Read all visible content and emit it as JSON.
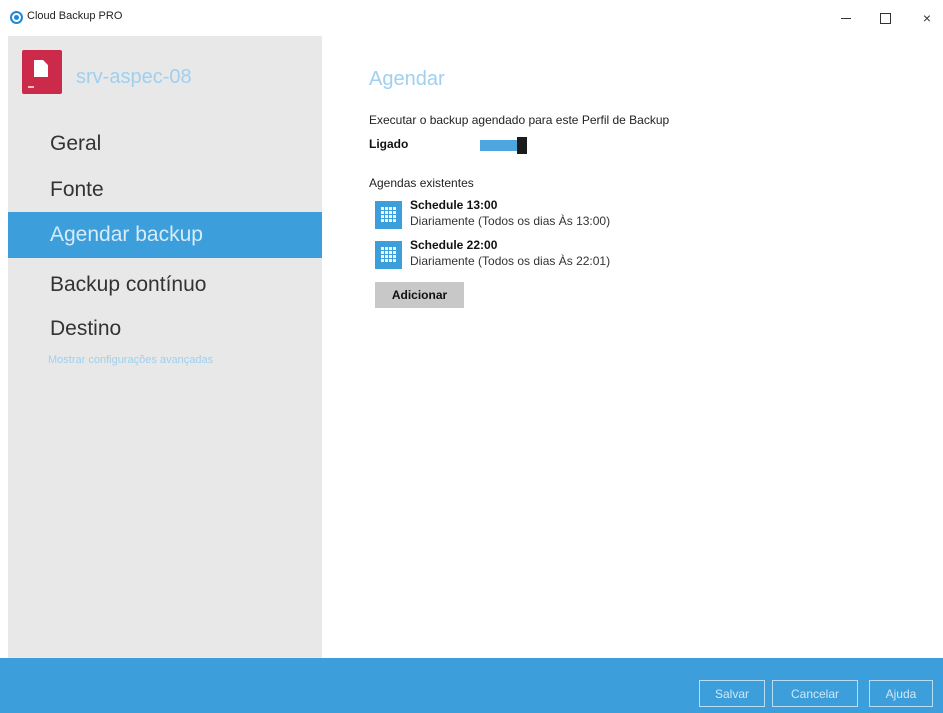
{
  "window": {
    "title": "Cloud Backup PRO",
    "minimize": "",
    "maximize": "",
    "close": "×"
  },
  "sidebar": {
    "profile_name": "srv-aspec-08",
    "items": [
      {
        "label": "Geral",
        "active": false
      },
      {
        "label": "Fonte",
        "active": false
      },
      {
        "label": "Agendar backup",
        "active": true
      },
      {
        "label": "Backup contínuo",
        "active": false
      },
      {
        "label": "Destino",
        "active": false
      }
    ],
    "advanced_link": "Mostrar configurações avançadas"
  },
  "main": {
    "title": "Agendar",
    "description": "Executar o backup agendado para este Perfil de Backup",
    "toggle_label": "Ligado",
    "toggle_on": true,
    "schedules_label": "Agendas existentes",
    "schedules": [
      {
        "name": "Schedule 13:00",
        "detail": "Diariamente (Todos os dias Às 13:00)"
      },
      {
        "name": "Schedule 22:00",
        "detail": "Diariamente (Todos os dias Às 22:01)"
      }
    ],
    "add_label": "Adicionar"
  },
  "footer": {
    "save_label": "Salvar",
    "cancel_label": "Cancelar",
    "help_label": "Ajuda"
  },
  "colors": {
    "accent": "#3c9fdb",
    "light_accent": "#9fd0ef",
    "profile_icon": "#cc2a4a",
    "sidebar_bg": "#e8e8e8"
  }
}
